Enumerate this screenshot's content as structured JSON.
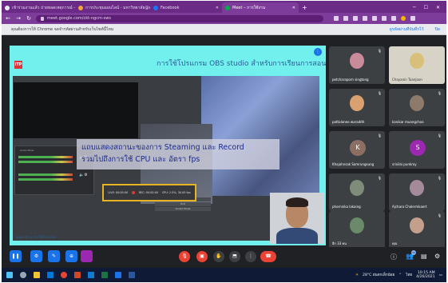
{
  "browser": {
    "tabs": [
      {
        "label": "เข้าร่วมงานแล้ว ถ่ายทอดเหตุการณ์ - Google",
        "active": false,
        "favicon_color": "#e8ecf4"
      },
      {
        "label": "การประชุมออนไลน์ - มหาวิทยาลัย@ครู",
        "active": false,
        "favicon_color": "#f2a33a"
      },
      {
        "label": "Facebook",
        "active": false,
        "favicon_color": "#1877f2"
      },
      {
        "label": "Meet – การใช้งาน",
        "active": true,
        "favicon_color": "#00ac47"
      }
    ],
    "new_tab_label": "+",
    "url": "meet.google.com/ckt-ngcm-sws",
    "infobar_message": "คุณต้องการให้ Chrome จดจำรหัสผ่านสำหรับเว็บไซต์นี้ไหม",
    "infobar_action_primary": "ดูรหัสผ่านที่บันทึกไว้",
    "infobar_action_secondary": "ปิด"
  },
  "presentation": {
    "logo_text": "ITP",
    "title": "การใช้โปรแกรม OBS studio สำหรับการเรียนการสอนออนไลน์",
    "caption_line1": "แถบแสดงสถานะของการ Steaming และ Record",
    "caption_line2": "รวมไปถึงการใช้ CPU และ อัตรา fps",
    "status_live": "LIVE: 00:00:00",
    "status_rec": "REC: 00:00:00",
    "status_cpu": "CPU: 2.5%, 30.00 fps",
    "mixer_label": "Audio Mixer",
    "footer_text": "www.itp.ac.th/OBS-studio",
    "menu_items": [
      "Settings",
      "Exit",
      "Studio Mode"
    ]
  },
  "participants": [
    {
      "name": "petcharaporn singtong",
      "avatar_color": "#c98a9a",
      "kind": "photo"
    },
    {
      "name": "Chayanin Tuanjoon",
      "avatar_color": "#d8c07a",
      "kind": "photo"
    },
    {
      "name": "pattalanee waradith",
      "avatar_color": "#d9a070",
      "kind": "photo"
    },
    {
      "name": "kanikar muangchoo",
      "avatar_color": "#8e7a6b",
      "kind": "photo"
    },
    {
      "name": "Khajohnsak Samrungsung",
      "avatar_color": "#8d6e63",
      "kind": "letter",
      "letter": "K"
    },
    {
      "name": "srivilai punkroy",
      "avatar_color": "#9c27b0",
      "kind": "letter",
      "letter": "S"
    },
    {
      "name": "phornnika lakaing",
      "avatar_color": "#7f8c7a",
      "kind": "photo"
    },
    {
      "name": "Ajchara Chalermkaert",
      "avatar_color": "#a58a9c",
      "kind": "photo"
    },
    {
      "name": "อีก 33 คน",
      "avatar_color": "#6a8a6a",
      "kind": "photo"
    },
    {
      "name": "คุณ",
      "avatar_color": "#c4a08c",
      "kind": "photo"
    }
  ],
  "controls": {
    "participant_count": "45",
    "colors": {
      "mic_off": "#ea4335",
      "end_call": "#ea4335",
      "sidebar_buttons": "#1a73e8",
      "share": "#9c27b0"
    }
  },
  "taskbar": {
    "weather": "28°C ฝนตกเล็กน้อย",
    "language": "ไทย",
    "time": "10:15 AM",
    "date": "4/26/2021"
  }
}
